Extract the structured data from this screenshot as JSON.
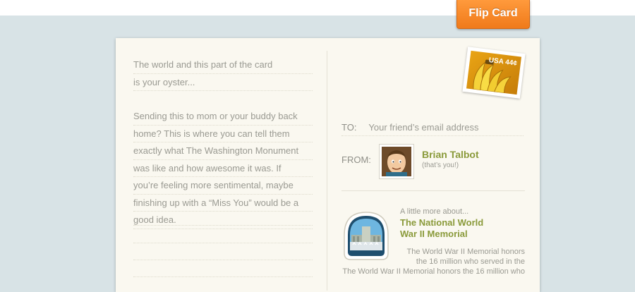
{
  "header": {
    "flip_button_label": "Flip Card"
  },
  "message": {
    "lines": [
      "The world and this part of the card",
      "is your oyster...",
      "",
      "Sending this to mom or your buddy back",
      "home? This is where you can tell them",
      "exactly what The Washington Monument",
      "was like and how awesome it was. If",
      "you’re feeling more sentimental, maybe",
      "finishing up with a “Miss You” would be a",
      "good idea."
    ]
  },
  "stamp": {
    "text": "USA 44¢",
    "icon": "bananas-stamp-icon"
  },
  "address": {
    "to_label": "TO:",
    "to_placeholder": "Your friend’s email address",
    "from_label": "FROM:",
    "sender_name": "Brian Talbot",
    "sender_note": "(that’s you!)",
    "avatar_icon": "cartoon-avatar"
  },
  "about": {
    "label": "A little more about...",
    "title_line1": "The National World",
    "title_line2": "War II Memorial",
    "body_lines": [
      "The World War II Memorial honors",
      "the 16 million who served in the",
      "The World War II Memorial honors the 16 million who"
    ],
    "badge_icon": "memorial-badge-icon"
  },
  "colors": {
    "background": "#d8e3e6",
    "accent_orange": "#f07a1a",
    "accent_green": "#8a9a3a",
    "card": "#faf8f0"
  }
}
